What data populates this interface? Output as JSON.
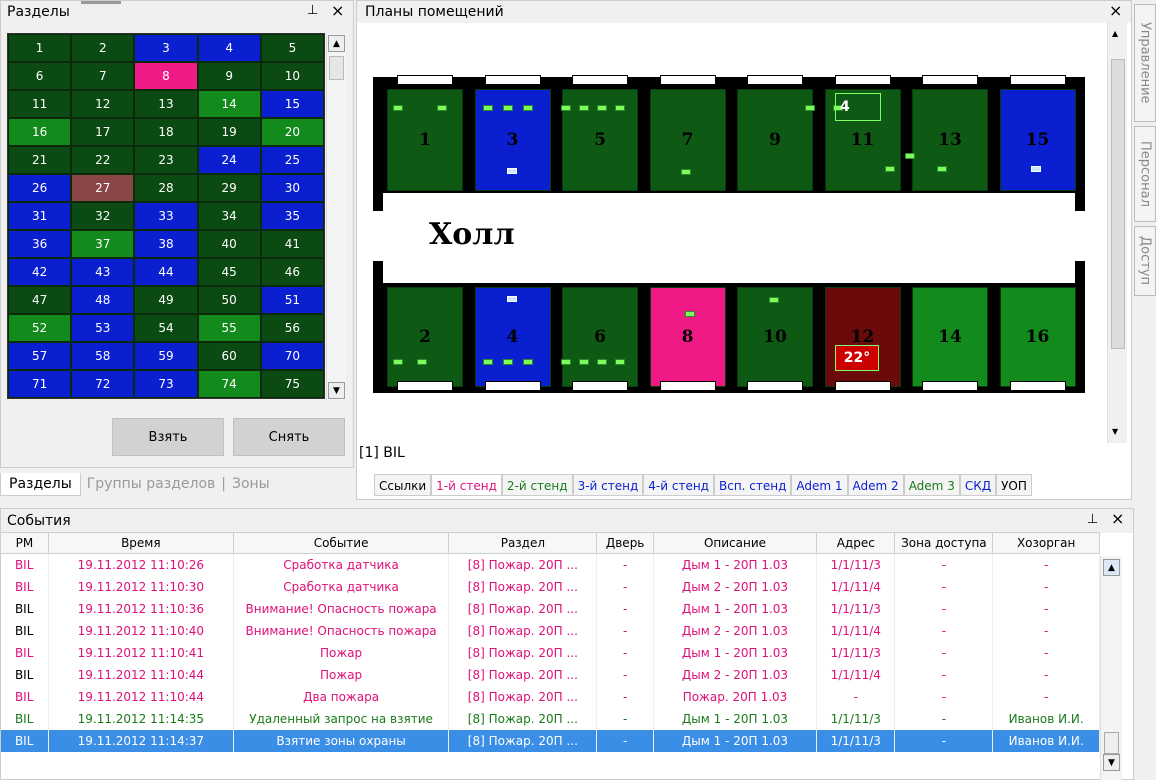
{
  "sections_panel": {
    "title": "Разделы",
    "pin": "ꟷ",
    "close": "×"
  },
  "grid_cells": [
    {
      "n": "1",
      "c": "dg"
    },
    {
      "n": "2",
      "c": "dg"
    },
    {
      "n": "3",
      "c": "b"
    },
    {
      "n": "4",
      "c": "b"
    },
    {
      "n": "5",
      "c": "dg"
    },
    {
      "n": "",
      "c": "none"
    },
    {
      "n": "6",
      "c": "dg"
    },
    {
      "n": "7",
      "c": "dg"
    },
    {
      "n": "8",
      "c": "p"
    },
    {
      "n": "9",
      "c": "dg"
    },
    {
      "n": "10",
      "c": "dg"
    },
    {
      "n": "",
      "c": "none"
    },
    {
      "n": "11",
      "c": "dg"
    },
    {
      "n": "12",
      "c": "dg"
    },
    {
      "n": "13",
      "c": "dg"
    },
    {
      "n": "14",
      "c": "g"
    },
    {
      "n": "15",
      "c": "b"
    },
    {
      "n": "",
      "c": "none"
    },
    {
      "n": "16",
      "c": "g"
    },
    {
      "n": "17",
      "c": "dg"
    },
    {
      "n": "18",
      "c": "dg"
    },
    {
      "n": "19",
      "c": "dg"
    },
    {
      "n": "20",
      "c": "g"
    },
    {
      "n": "",
      "c": "none"
    },
    {
      "n": "21",
      "c": "dg"
    },
    {
      "n": "22",
      "c": "dg"
    },
    {
      "n": "23",
      "c": "dg"
    },
    {
      "n": "24",
      "c": "b"
    },
    {
      "n": "25",
      "c": "b"
    },
    {
      "n": "",
      "c": "none"
    },
    {
      "n": "26",
      "c": "b"
    },
    {
      "n": "27",
      "c": "br"
    },
    {
      "n": "28",
      "c": "dg"
    },
    {
      "n": "29",
      "c": "dg"
    },
    {
      "n": "30",
      "c": "b"
    },
    {
      "n": "",
      "c": "none"
    },
    {
      "n": "31",
      "c": "b"
    },
    {
      "n": "32",
      "c": "dg"
    },
    {
      "n": "33",
      "c": "b"
    },
    {
      "n": "34",
      "c": "dg"
    },
    {
      "n": "35",
      "c": "b"
    },
    {
      "n": "",
      "c": "none"
    },
    {
      "n": "36",
      "c": "b"
    },
    {
      "n": "37",
      "c": "g"
    },
    {
      "n": "38",
      "c": "b"
    },
    {
      "n": "40",
      "c": "dg"
    },
    {
      "n": "41",
      "c": "dg"
    },
    {
      "n": "",
      "c": "none"
    },
    {
      "n": "42",
      "c": "b"
    },
    {
      "n": "43",
      "c": "b"
    },
    {
      "n": "44",
      "c": "b"
    },
    {
      "n": "45",
      "c": "dg"
    },
    {
      "n": "46",
      "c": "dg"
    },
    {
      "n": "",
      "c": "none"
    },
    {
      "n": "47",
      "c": "dg"
    },
    {
      "n": "48",
      "c": "b"
    },
    {
      "n": "49",
      "c": "dg"
    },
    {
      "n": "50",
      "c": "dg"
    },
    {
      "n": "51",
      "c": "b"
    },
    {
      "n": "",
      "c": "none"
    },
    {
      "n": "52",
      "c": "g"
    },
    {
      "n": "53",
      "c": "b"
    },
    {
      "n": "54",
      "c": "dg"
    },
    {
      "n": "55",
      "c": "g"
    },
    {
      "n": "56",
      "c": "dg"
    },
    {
      "n": "",
      "c": "none"
    },
    {
      "n": "57",
      "c": "b"
    },
    {
      "n": "58",
      "c": "b"
    },
    {
      "n": "59",
      "c": "b"
    },
    {
      "n": "60",
      "c": "dg"
    },
    {
      "n": "70",
      "c": "b"
    },
    {
      "n": "",
      "c": "none"
    },
    {
      "n": "71",
      "c": "b"
    },
    {
      "n": "72",
      "c": "b"
    },
    {
      "n": "73",
      "c": "b"
    },
    {
      "n": "74",
      "c": "g"
    },
    {
      "n": "75",
      "c": "dg"
    },
    {
      "n": "",
      "c": "none"
    }
  ],
  "buttons": {
    "take": "Взять",
    "release": "Снять"
  },
  "left_tabs": {
    "sections": "Разделы",
    "groups": "Группы разделов",
    "zones": "Зоны",
    "sep": "|"
  },
  "plan": {
    "title": "Планы помещений",
    "hall": "Холл",
    "caption": "[1] BIL",
    "badge_top": "4",
    "temp": "22°",
    "rooms_top": [
      "1",
      "3",
      "5",
      "7",
      "9",
      "11",
      "13",
      "15"
    ],
    "rooms_bottom": [
      "2",
      "4",
      "6",
      "8",
      "10",
      "12",
      "14",
      "16"
    ]
  },
  "floor_tabs": [
    "Ссылки",
    "1-й стенд",
    "2-й стенд",
    "3-й стенд",
    "4-й стенд",
    "Всп. стенд",
    "Adem 1",
    "Adem 2",
    "Adem 3",
    "СКД",
    "УОП"
  ],
  "events_panel": {
    "title": "События"
  },
  "columns": [
    "РМ",
    "Время",
    "Событие",
    "Раздел",
    "Дверь",
    "Описание",
    "Адрес",
    "Зона доступа",
    "Хозорган"
  ],
  "rows": [
    {
      "s": "pink",
      "rm": "BIL",
      "t": "19.11.2012 11:10:26",
      "e": "Сработка датчика",
      "r": "[8] Пожар. 20П ...",
      "d": "-",
      "o": "Дым 1 - 20П 1.03",
      "a": "1/1/11/3",
      "z": "-",
      "h": "-"
    },
    {
      "s": "pink",
      "rm": "BIL",
      "t": "19.11.2012 11:10:30",
      "e": "Сработка датчика",
      "r": "[8] Пожар. 20П ...",
      "d": "-",
      "o": "Дым 2 - 20П 1.03",
      "a": "1/1/11/4",
      "z": "-",
      "h": "-"
    },
    {
      "s": "pink",
      "rm": "BIL",
      "t": "19.11.2012 11:10:36",
      "e": "Внимание! Опасность пожара",
      "r": "[8] Пожар. 20П ...",
      "d": "-",
      "o": "Дым 1 - 20П 1.03",
      "a": "1/1/11/3",
      "z": "-",
      "h": "-"
    },
    {
      "s": "pink",
      "rm": "BIL",
      "t": "19.11.2012 11:10:40",
      "e": "Внимание! Опасность пожара",
      "r": "[8] Пожар. 20П ...",
      "d": "-",
      "o": "Дым 2 - 20П 1.03",
      "a": "1/1/11/4",
      "z": "-",
      "h": "-"
    },
    {
      "s": "pink",
      "rm": "BIL",
      "t": "19.11.2012 11:10:41",
      "e": "Пожар",
      "r": "[8] Пожар. 20П ...",
      "d": "-",
      "o": "Дым 1 - 20П 1.03",
      "a": "1/1/11/3",
      "z": "-",
      "h": "-"
    },
    {
      "s": "pink",
      "rm": "BIL",
      "t": "19.11.2012 11:10:44",
      "e": "Пожар",
      "r": "[8] Пожар. 20П ...",
      "d": "-",
      "o": "Дым 2 - 20П 1.03",
      "a": "1/1/11/4",
      "z": "-",
      "h": "-"
    },
    {
      "s": "pink",
      "rm": "BIL",
      "t": "19.11.2012 11:10:44",
      "e": "Два пожара",
      "r": "[8] Пожар. 20П ...",
      "d": "-",
      "o": "Пожар. 20П 1.03",
      "a": "-",
      "z": "-",
      "h": "-"
    },
    {
      "s": "green",
      "rm": "BIL",
      "t": "19.11.2012 11:14:35",
      "e": "Удаленный запрос на взятие",
      "r": "[8] Пожар. 20П ...",
      "d": "-",
      "o": "Дым 1 - 20П 1.03",
      "a": "1/1/11/3",
      "z": "-",
      "h": "Иванов И.И."
    },
    {
      "s": "sel",
      "rm": "BIL",
      "t": "19.11.2012 11:14:37",
      "e": "Взятие зоны охраны",
      "r": "[8] Пожар. 20П ...",
      "d": "-",
      "o": "Дым 1 - 20П 1.03",
      "a": "1/1/11/3",
      "z": "-",
      "h": "Иванов И.И."
    }
  ],
  "side_tabs": [
    "Управление",
    "Персонал",
    "Доступ"
  ]
}
